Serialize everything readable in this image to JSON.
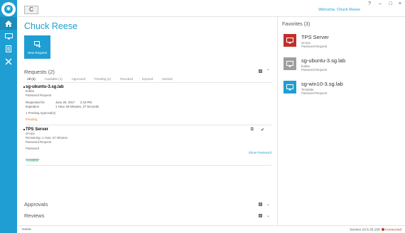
{
  "titlebar": {
    "welcome": "Welcome, Chuck Reese",
    "refresh_glyph": "C",
    "controls": [
      "?",
      "–",
      "□",
      "×"
    ]
  },
  "user": {
    "name": "Chuck Reese"
  },
  "tile": {
    "label": "New Request",
    "color": "#1e9ed2"
  },
  "requests": {
    "title": "Requests (2)",
    "tabs": [
      "All (2)",
      "Available (1)",
      "Approved",
      "Pending (1)",
      "Revoked",
      "Expired",
      "Denied"
    ],
    "items": [
      {
        "name": "sg-ubuntu-3.sg.lab",
        "account": "bobba",
        "type": "Password Request",
        "requested_for_label": "Requested for",
        "requested_for_value": "June 26, 2017",
        "requested_for_time": "2:15 PM",
        "duration_label": "Expiration",
        "duration_value": "1 Hour, 59 Minutes, 27 Seconds",
        "approvals": "1 Pending Approval(s)",
        "status": "Pending"
      },
      {
        "name": "TPS Server",
        "account": "sm-tps",
        "remaining": "Remaining: 1 Hour, 57 Minutes",
        "type": "Password Request",
        "password_label": "Password",
        "password_value": "••••••••••••••",
        "show_password": "Show Password",
        "status": "Available"
      }
    ]
  },
  "approvals": {
    "title": "Approvals"
  },
  "reviews": {
    "title": "Reviews"
  },
  "favorites": {
    "title": "Favorites (3)",
    "items": [
      {
        "name": "TPS Server",
        "account": "sm-tps",
        "type": "Password Request",
        "color": "#c0302b"
      },
      {
        "name": "sg-ubuntu-3.sg.lab",
        "account": "bobba",
        "type": "Password Request",
        "color": "#9e9e9e"
      },
      {
        "name": "sg-win10-3.sg.lab",
        "account": "Template",
        "type": "Password Request",
        "color": "#1e9ed2"
      }
    ]
  },
  "statusbar": {
    "left": "Home",
    "service": "Service 10.5.33.156",
    "connection": "Connected"
  }
}
